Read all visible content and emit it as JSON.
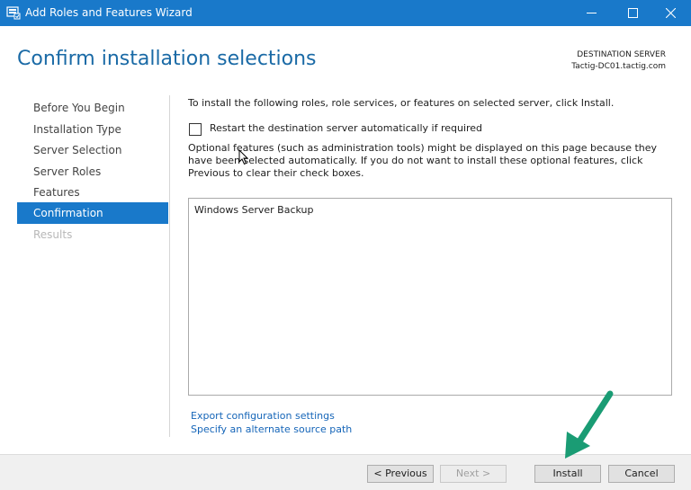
{
  "window": {
    "title": "Add Roles and Features Wizard",
    "accent_color": "#1979ca"
  },
  "header": {
    "title": "Confirm installation selections",
    "destination_label": "DESTINATION SERVER",
    "destination_value": "Tactig-DC01.tactig.com"
  },
  "sidebar": {
    "items": [
      {
        "label": "Before You Begin",
        "state": "normal"
      },
      {
        "label": "Installation Type",
        "state": "normal"
      },
      {
        "label": "Server Selection",
        "state": "normal"
      },
      {
        "label": "Server Roles",
        "state": "normal"
      },
      {
        "label": "Features",
        "state": "normal"
      },
      {
        "label": "Confirmation",
        "state": "active"
      },
      {
        "label": "Results",
        "state": "disabled"
      }
    ]
  },
  "main": {
    "intro": "To install the following roles, role services, or features on selected server, click Install.",
    "restart_checkbox": {
      "label": "Restart the destination server automatically if required",
      "checked": false
    },
    "optional_text": "Optional features (such as administration tools) might be displayed on this page because they have been selected automatically. If you do not want to install these optional features, click Previous to clear their check boxes.",
    "features": [
      "Windows Server Backup"
    ],
    "links": {
      "export": "Export configuration settings",
      "alternate_source": "Specify an alternate source path"
    }
  },
  "footer": {
    "previous_label": "< Previous",
    "next_label": "Next >",
    "install_label": "Install",
    "cancel_label": "Cancel"
  },
  "icons": {
    "app": "server-manager-icon",
    "minimize": "minimize-icon",
    "maximize": "maximize-icon",
    "close": "close-icon",
    "cursor": "mouse-cursor-icon",
    "annotation": "green-arrow-icon",
    "annotation_color": "#1a9c74"
  }
}
